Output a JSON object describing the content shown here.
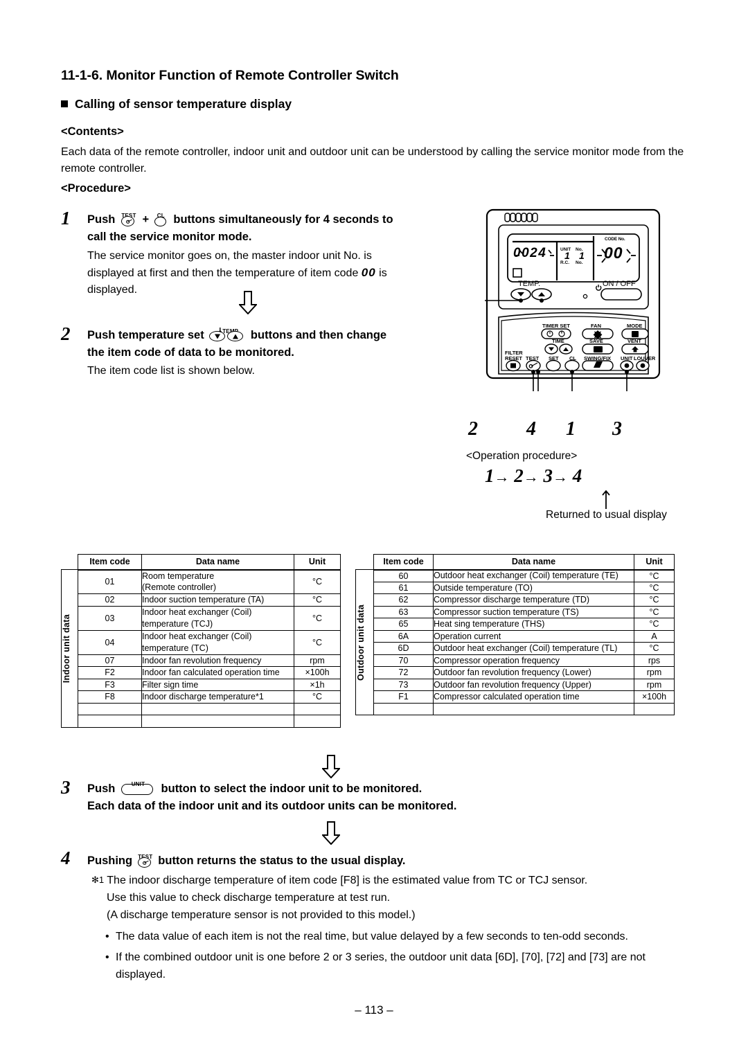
{
  "header": {
    "section_number_title": "11-1-6. Monitor Function of Remote Controller Switch",
    "bullet_title": "Calling of sensor temperature display",
    "contents_label": "<Contents>",
    "contents_text": "Each data of the remote controller, indoor unit and outdoor unit can be understood by calling the service monitor mode from the remote controller.",
    "procedure_label": "<Procedure>"
  },
  "steps": {
    "s1": {
      "num": "1",
      "cap_test": "TEST",
      "cap_cl": "CL",
      "text_a": "Push",
      "text_plus": "+",
      "text_b": "buttons simultaneously for 4 seconds to",
      "text_c": "call the service monitor mode.",
      "sub_line1": "The service monitor goes on, the master indoor unit No. is",
      "sub_line2a": "displayed at first and then the temperature of item code",
      "sub_code": "00",
      "sub_line2b": "is",
      "sub_line3": "displayed."
    },
    "s2": {
      "num": "2",
      "cap_temp": "TEMP.",
      "text_a": "Push temperature set",
      "text_b": "buttons and then change",
      "text_c": "the item code of data to be monitored.",
      "sub_line1": "The item code list is shown below."
    },
    "s3": {
      "num": "3",
      "cap_unit": "UNIT",
      "text_a": "Push",
      "text_b": "button to select the indoor unit to be monitored.",
      "text_c": "Each data of the indoor unit and its outdoor units can be monitored."
    },
    "s4": {
      "num": "4",
      "cap_test": "TEST",
      "text_a": "Pushing",
      "text_b": "button returns the status to the usual display."
    }
  },
  "remote": {
    "lcd_left_value": "0024",
    "lcd_unit_label": "UNIT",
    "lcd_no_label": "No.",
    "lcd_rc_label": "R.C.",
    "lcd_no2_label": "No.",
    "lcd_unit_value": "1",
    "lcd_rc_value": "1",
    "lcd_code_label": "CODE No.",
    "lcd_code_value": "00",
    "temp_label": "TEMP.",
    "onoff_label": "ON / OFF",
    "timer_set_label": "TIMER SET",
    "fan_label": "FAN",
    "mode_label": "MODE",
    "time_label": "TIME",
    "save_label": "SAVE",
    "vent_label": "VENT",
    "filter_label": "FILTER",
    "reset_label": "RESET",
    "test_label": "TEST",
    "set_label": "SET",
    "cl_label": "CL",
    "swing_fix_label": "SWING/FIX",
    "unit_label": "UNIT",
    "louver_label": "LOUVER"
  },
  "callouts": {
    "c_temp": "2",
    "c_test": "4",
    "c_cl": "1",
    "c_unit": "3",
    "operation_procedure_label": "<Operation procedure>",
    "seq": [
      "1",
      "2",
      "3",
      "4"
    ],
    "seq_arrow": "→",
    "returned_label": "Returned to usual display"
  },
  "table_indoor": {
    "side_label": "Indoor unit data",
    "headers": [
      "Item code",
      "Data name",
      "Unit"
    ],
    "rows": [
      {
        "code": "01",
        "name": "Room temperature\n(Remote controller)",
        "unit": "°C",
        "two_line": true
      },
      {
        "code": "02",
        "name": "Indoor suction temperature (TA)",
        "unit": "°C",
        "two_line": false
      },
      {
        "code": "03",
        "name": "Indoor heat exchanger (Coil)\ntemperature (TCJ)",
        "unit": "°C",
        "two_line": true
      },
      {
        "code": "04",
        "name": "Indoor heat exchanger (Coil)\ntemperature (TC)",
        "unit": "°C",
        "two_line": true
      },
      {
        "code": "07",
        "name": "Indoor fan revolution frequency",
        "unit": "rpm",
        "two_line": false
      },
      {
        "code": "F2",
        "name": "Indoor fan calculated operation time",
        "unit": "×100h",
        "two_line": false
      },
      {
        "code": "F3",
        "name": "Filter sign time",
        "unit": "×1h",
        "two_line": false
      },
      {
        "code": "F8",
        "name": "Indoor discharge temperature*1",
        "unit": "°C",
        "two_line": false
      }
    ]
  },
  "table_outdoor": {
    "side_label": "Outdoor unit data",
    "headers": [
      "Item code",
      "Data name",
      "Unit"
    ],
    "rows": [
      {
        "code": "60",
        "name": "Outdoor heat exchanger (Coil) temperature (TE)",
        "unit": "°C"
      },
      {
        "code": "61",
        "name": "Outside temperature (TO)",
        "unit": "°C"
      },
      {
        "code": "62",
        "name": "Compressor discharge temperature (TD)",
        "unit": "°C"
      },
      {
        "code": "63",
        "name": "Compressor suction temperature (TS)",
        "unit": "°C"
      },
      {
        "code": "65",
        "name": "Heat sing temperature (THS)",
        "unit": "°C"
      },
      {
        "code": "6A",
        "name": "Operation current",
        "unit": "A"
      },
      {
        "code": "6D",
        "name": "Outdoor heat exchanger (Coil) temperature (TL)",
        "unit": "°C"
      },
      {
        "code": "70",
        "name": "Compressor operation frequency",
        "unit": "rps"
      },
      {
        "code": "72",
        "name": "Outdoor fan revolution frequency (Lower)",
        "unit": "rpm"
      },
      {
        "code": "73",
        "name": "Outdoor fan revolution frequency (Upper)",
        "unit": "rpm"
      },
      {
        "code": "F1",
        "name": "Compressor calculated operation time",
        "unit": "×100h"
      }
    ]
  },
  "notes": {
    "star_marker": "✻1",
    "star_line1": "The indoor discharge temperature of item code [F8] is the estimated value from TC or TCJ sensor.",
    "star_line2": "Use this value to check discharge temperature at test run.",
    "star_line3": "(A discharge temperature sensor is not provided to this model.)",
    "bullet1": "The data value of each item is not the real time, but value delayed by a few seconds to ten-odd seconds.",
    "bullet2": "If the combined outdoor unit is one before 2 or 3 series, the outdoor unit data [6D], [70], [72] and [73] are not displayed."
  },
  "footer": {
    "page_number": "– 113 –"
  }
}
